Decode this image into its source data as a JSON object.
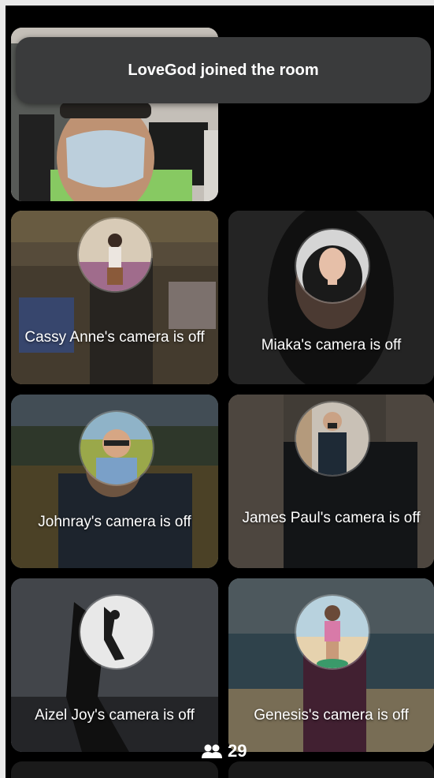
{
  "toast": {
    "message": "LoveGod joined the room"
  },
  "participants": [
    {
      "name": "LoveGod",
      "camera_off_label": ""
    },
    {
      "name": "Cassy Anne",
      "camera_off_label": "Cassy Anne's camera is off"
    },
    {
      "name": "Miaka",
      "camera_off_label": "Miaka's camera is off"
    },
    {
      "name": "Johnray",
      "camera_off_label": "Johnray's camera is off"
    },
    {
      "name": "James Paul",
      "camera_off_label": "James Paul's camera is off"
    },
    {
      "name": "Aizel Joy",
      "camera_off_label": "Aizel Joy's camera is off"
    },
    {
      "name": "Genesis",
      "camera_off_label": "Genesis's camera is off"
    }
  ],
  "participant_count": {
    "icon": "people-icon",
    "value": "29"
  }
}
